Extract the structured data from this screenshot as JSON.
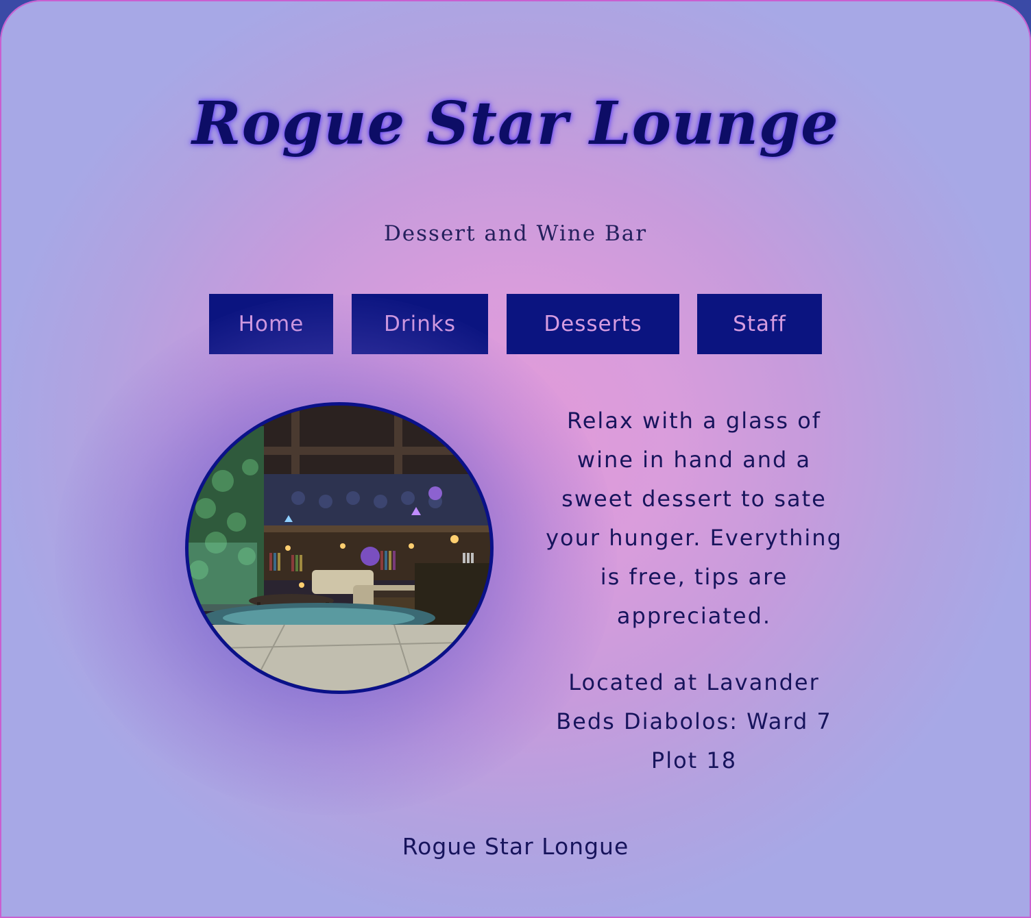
{
  "site": {
    "title": "Rogue Star Lounge",
    "subtitle": "Dessert and Wine Bar"
  },
  "nav": {
    "items": [
      {
        "label": "Home"
      },
      {
        "label": "Drinks"
      },
      {
        "label": "Desserts"
      },
      {
        "label": "Staff"
      }
    ]
  },
  "main": {
    "description": "Relax with a glass of wine in hand and a sweet dessert to sate your hunger. Everything is free, tips are appreciated.",
    "location": "Located at Lavander Beds Diabolos: Ward 7 Plot 18",
    "photo_icon": "lounge-interior-photo"
  },
  "footer": {
    "text": "Rogue Star Longue"
  },
  "colors": {
    "nav_bg": "#0b1480",
    "nav_text": "#d69ce0",
    "title_text": "#0d0d66",
    "body_text": "#17145c",
    "page_bg_center": "#e29ad9",
    "page_bg_edge": "#a7a8e6",
    "photo_border": "#0a1189"
  }
}
